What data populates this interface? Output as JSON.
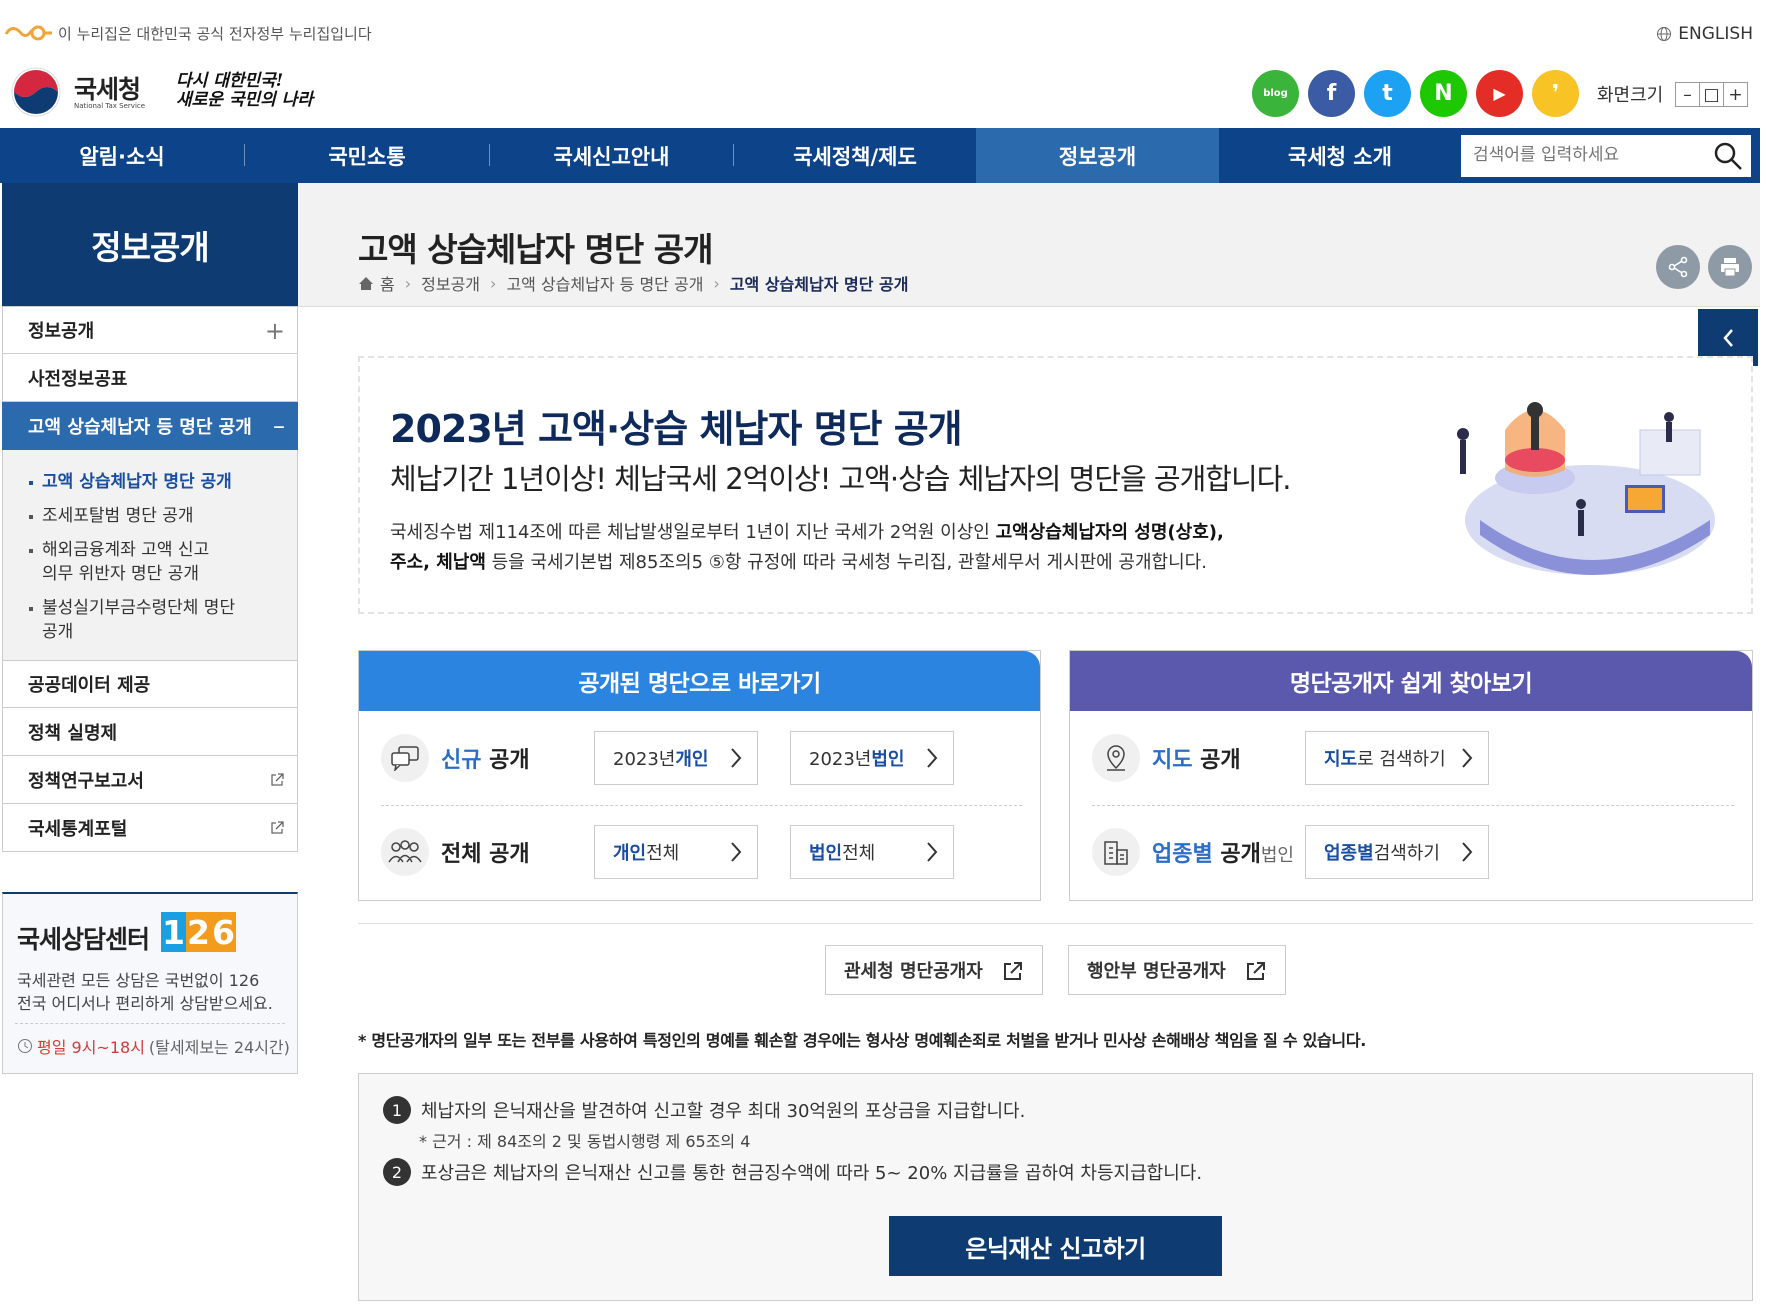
{
  "gov": {
    "notice": "이 누리집은 대한민국 공식 전자정부 누리집입니다",
    "english": "ENGLISH"
  },
  "logo": {
    "name": "국세청",
    "sub": "National Tax Service",
    "slogan_1": "다시 대한민국!",
    "slogan_2": "새로운 국민의 나라"
  },
  "sns": [
    {
      "label": "blog",
      "color": "#3bb43c"
    },
    {
      "label": "f",
      "color": "#3b5ba5"
    },
    {
      "label": "t",
      "color": "#1da1f2"
    },
    {
      "label": "N",
      "color": "#1ec800"
    },
    {
      "label": "▶",
      "color": "#e52d27"
    },
    {
      "label": "❜",
      "color": "#f7c325"
    }
  ],
  "screen_size": {
    "label": "화면크기",
    "minus": "–",
    "reset": "□",
    "plus": "+"
  },
  "gnb": [
    "알림·소식",
    "국민소통",
    "국세신고안내",
    "국세정책/제도",
    "정보공개",
    "국세청 소개"
  ],
  "search": {
    "placeholder": "검색어를 입력하세요"
  },
  "page": {
    "title": "고액 상습체납자 명단 공개",
    "breadcrumb": [
      "홈",
      "정보공개",
      "고액 상습체납자 등 명단 공개",
      "고액 상습체납자 명단 공개"
    ]
  },
  "lnb": {
    "title": "정보공개",
    "items": [
      {
        "label": "정보공개",
        "mark": "+"
      },
      {
        "label": "사전정보공표",
        "mark": ""
      },
      {
        "label": "고액 상습체납자 등 명단 공개",
        "mark": "–"
      },
      {
        "label": "공공데이터 제공",
        "mark": ""
      },
      {
        "label": "정책 실명제",
        "mark": ""
      },
      {
        "label": "정책연구보고서",
        "mark": ""
      },
      {
        "label": "국세통계포털",
        "mark": ""
      }
    ],
    "sub": [
      "고액 상습체납자 명단 공개",
      "조세포탈범 명단 공개",
      "해외금융계좌 고액 신고\n의무 위반자 명단 공개",
      "불성실기부금수령단체 명단\n공개"
    ]
  },
  "counsel": {
    "title": "국세상담센터",
    "number": [
      "1",
      "2",
      "6"
    ],
    "desc_1": "국세관련 모든 상담은 국번없이 126",
    "desc_2": "전국 어디서나 편리하게 상담받으세요.",
    "time_red": "평일 9시~18시",
    "time_rest": "(탈세제보는 24시간)"
  },
  "banner": {
    "title": "2023년 고액·상습 체납자 명단 공개",
    "subtitle": "체납기간 1년이상! 체납국세 2억이상! 고액·상습 체납자의 명단을 공개합니다.",
    "desc_1a": "국세징수법 제114조에 따른 체납발생일로부터 1년이 지난 국세가 2억원 이상인 ",
    "desc_1b": "고액상습체납자의 성명(상호),",
    "desc_2a": "주소, 체납액",
    "desc_2b": " 등을 국세기본법 제85조의5 ⑤항 규정에 따라 국세청 누리집, 관할세무서 게시판에 공개합니다."
  },
  "panel_left": {
    "header": "공개된 명단으로 바로가기",
    "row1": {
      "a": "신규",
      "b": " 공개",
      "btn1_a": "2023년 ",
      "btn1_b": "개인",
      "btn2_a": "2023년 ",
      "btn2_b": "법인"
    },
    "row2": {
      "a": "전체 공개",
      "btn1_a": "개인",
      "btn1_b": " 전체",
      "btn2_a": "법인",
      "btn2_b": " 전체"
    }
  },
  "panel_right": {
    "header": "명단공개자 쉽게 찾아보기",
    "row1": {
      "a": "지도",
      "b": " 공개",
      "btn_a": "지도",
      "btn_b": "로 검색하기"
    },
    "row2": {
      "a": "업종별",
      "b": " 공개",
      "c": "법인",
      "btn_a": "업종별",
      "btn_b": " 검색하기"
    }
  },
  "links": [
    "관세청 명단공개자",
    "행안부 명단공개자"
  ],
  "notice": "* 명단공개자의 일부 또는 전부를 사용하여 특정인의 명예를 훼손할 경우에는 형사상 명예훼손죄로 처벌을 받거나 민사상 손해배상 책임을 질 수 있습니다.",
  "reward": {
    "n1": "1",
    "item1": "체납자의 은닉재산을 발견하여 신고할 경우 최대 30억원의 포상금을 지급합니다.",
    "note": "* 근거 : 제 84조의 2 및 동법시행령 제 65조의 4",
    "n2": "2",
    "item2": "포상금은 체납자의 은닉재산 신고를 통한 현금징수액에 따라 5~ 20% 지급률을 곱하여 차등지급합니다.",
    "button": "은닉재산 신고하기"
  }
}
